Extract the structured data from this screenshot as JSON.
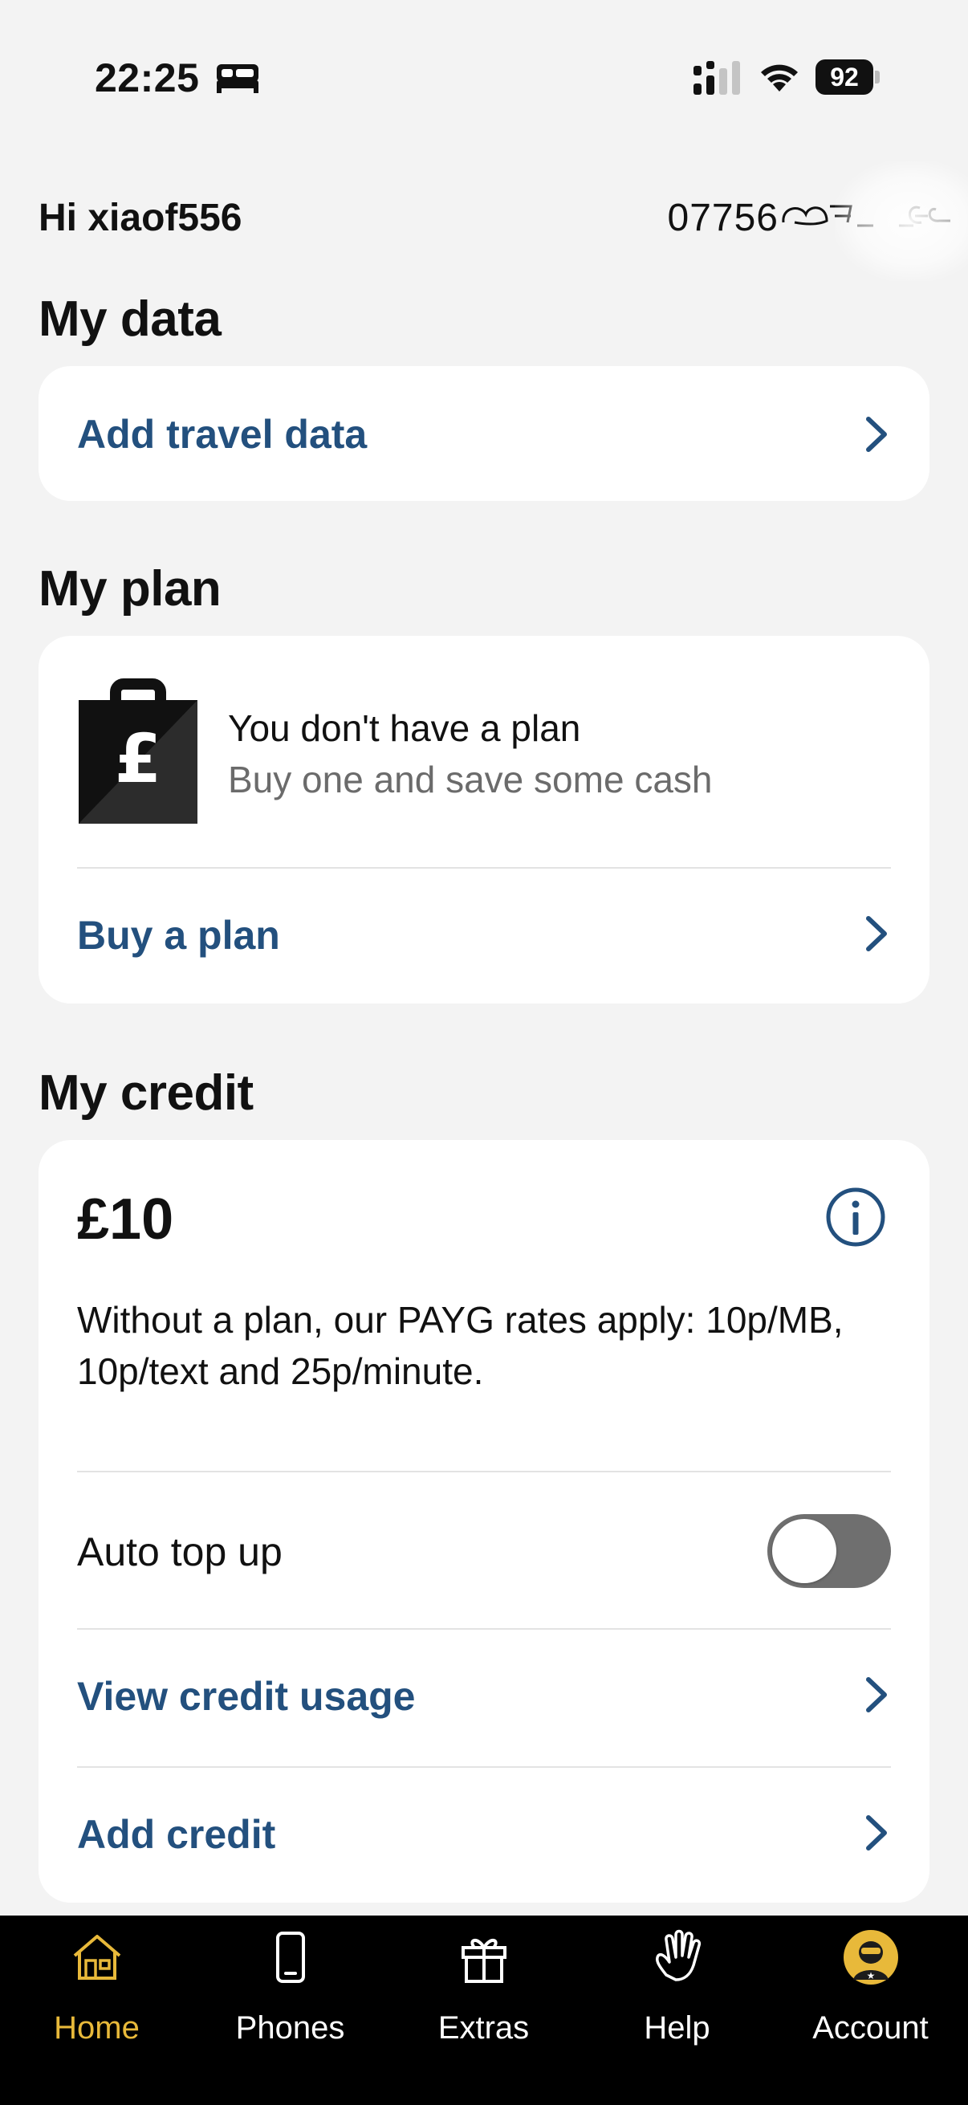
{
  "status_bar": {
    "time": "22:25",
    "battery": "92"
  },
  "header": {
    "greeting": "Hi xiaof556",
    "phone_number": "07756"
  },
  "my_data": {
    "title": "My data",
    "add_travel_data": "Add travel data"
  },
  "my_plan": {
    "title": "My plan",
    "no_plan": "You don't have a plan",
    "no_plan_sub": "Buy one and save some cash",
    "buy_plan": "Buy a plan"
  },
  "my_credit": {
    "title": "My credit",
    "amount": "£10",
    "payg_text": "Without a plan, our PAYG rates apply: 10p/MB, 10p/text and 25p/minute.",
    "auto_top_up": "Auto top up",
    "auto_top_up_enabled": false,
    "view_usage": "View credit usage",
    "add_credit": "Add credit"
  },
  "tabs": [
    {
      "label": "Home",
      "icon": "home-icon",
      "active": true
    },
    {
      "label": "Phones",
      "icon": "phone-icon",
      "active": false
    },
    {
      "label": "Extras",
      "icon": "gift-icon",
      "active": false
    },
    {
      "label": "Help",
      "icon": "hand-icon",
      "active": false
    },
    {
      "label": "Account",
      "icon": "avatar-icon",
      "active": false
    }
  ],
  "colors": {
    "link": "#23507e",
    "accent": "#e8b93a",
    "background": "#f3f3f3"
  }
}
